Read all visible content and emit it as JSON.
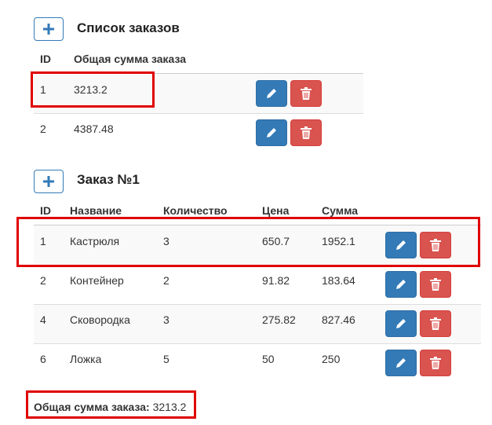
{
  "orders_list": {
    "add_icon": "plus-icon",
    "title": "Список заказов",
    "columns": [
      "ID",
      "Общая сумма заказа"
    ],
    "rows": [
      {
        "id": "1",
        "total": "3213.2"
      },
      {
        "id": "2",
        "total": "4387.48"
      }
    ]
  },
  "order_detail": {
    "add_icon": "plus-icon",
    "title": "Заказ №1",
    "columns": [
      "ID",
      "Название",
      "Количество",
      "Цена",
      "Сумма"
    ],
    "rows": [
      {
        "id": "1",
        "name": "Кастрюля",
        "qty": "3",
        "price": "650.7",
        "sum": "1952.1"
      },
      {
        "id": "2",
        "name": "Контейнер",
        "qty": "2",
        "price": "91.82",
        "sum": "183.64"
      },
      {
        "id": "4",
        "name": "Сковородка",
        "qty": "3",
        "price": "275.82",
        "sum": "827.46"
      },
      {
        "id": "6",
        "name": "Ложка",
        "qty": "5",
        "price": "50",
        "sum": "250"
      }
    ]
  },
  "summary": {
    "label": "Общая сумма заказа:",
    "value": "3213.2"
  },
  "icons": {
    "edit": "pencil-icon",
    "delete": "trash-icon"
  },
  "colors": {
    "primary": "#337ab7",
    "danger": "#d9534f",
    "highlight": "#e00000",
    "stripe": "#f9f9f9"
  }
}
